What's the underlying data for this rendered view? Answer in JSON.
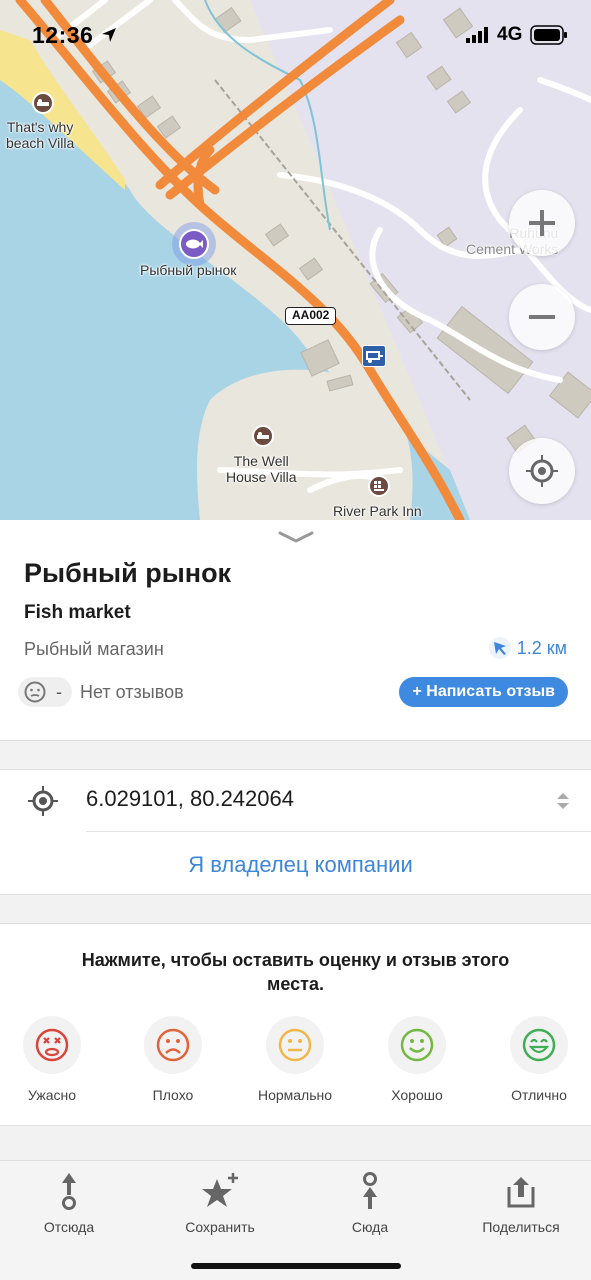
{
  "status_bar": {
    "time": "12:36",
    "network": "4G"
  },
  "map": {
    "labels": {
      "beach_villa": "That's why\nbeach Villa",
      "fish_market": "Рыбный рынок",
      "cement_works": "Ruhunu\nCement Works",
      "well_house": "The Well\nHouse Villa",
      "river_park": "River Park Inn",
      "road_shield": "AA002"
    },
    "buttons": {
      "zoom_in": "+",
      "zoom_out": "−"
    }
  },
  "place": {
    "title": "Рыбный рынок",
    "subtitle": "Fish market",
    "category": "Рыбный магазин",
    "distance": "1.2 км",
    "rating_value": "-",
    "reviews_status": "Нет отзывов",
    "write_review_label": "+ Написать отзыв"
  },
  "coordinates": {
    "value": "6.029101, 80.242064"
  },
  "owner_link": "Я владелец компании",
  "rating": {
    "prompt": "Нажмите, чтобы оставить оценку и отзыв этого места.",
    "options": [
      {
        "label": "Ужасно",
        "color": "#d9453b"
      },
      {
        "label": "Плохо",
        "color": "#e0633a"
      },
      {
        "label": "Нормально",
        "color": "#f0b74a"
      },
      {
        "label": "Хорошо",
        "color": "#73b941"
      },
      {
        "label": "Отлично",
        "color": "#3fae55"
      }
    ]
  },
  "bottom_bar": [
    {
      "label": "Отсюда",
      "icon": "route-from-icon"
    },
    {
      "label": "Сохранить",
      "icon": "star-add-icon"
    },
    {
      "label": "Сюда",
      "icon": "route-to-icon"
    },
    {
      "label": "Поделиться",
      "icon": "share-icon"
    }
  ],
  "colors": {
    "accent": "#3e8ae0",
    "road": "#f28a3c",
    "water": "#a9d4e6",
    "land": "#e9e6dd"
  }
}
